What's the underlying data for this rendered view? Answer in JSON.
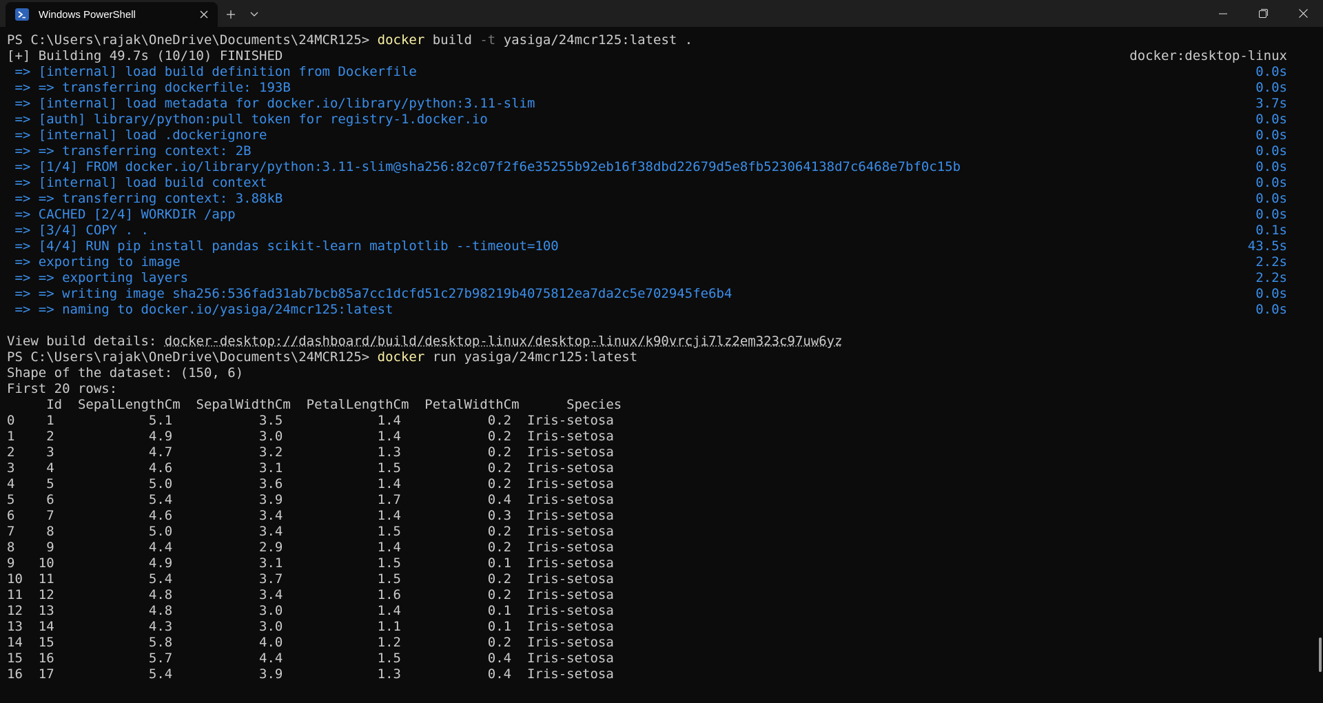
{
  "window": {
    "tab_title": "Windows PowerShell",
    "tab_icon": "powershell-icon",
    "colors": {
      "titlebar": "#1f1f1f",
      "terminal_bg": "#0c0c0c",
      "command": "#f9f1a5",
      "build_step": "#3b8eea",
      "text": "#cccccc"
    }
  },
  "terminal": {
    "prompt1": "PS C:\\Users\\rajak\\OneDrive\\Documents\\24MCR125> ",
    "cmd1_name": "docker",
    "cmd1_pre": " build ",
    "cmd1_flag": "-t",
    "cmd1_post": " yasiga/24mcr125:latest .",
    "build_header": "[+] Building 49.7s (10/10) FINISHED",
    "build_context": "docker:desktop-linux",
    "steps": [
      {
        "text": " => [internal] load build definition from Dockerfile",
        "time": "0.0s"
      },
      {
        "text": " => => transferring dockerfile: 193B",
        "time": "0.0s"
      },
      {
        "text": " => [internal] load metadata for docker.io/library/python:3.11-slim",
        "time": "3.7s"
      },
      {
        "text": " => [auth] library/python:pull token for registry-1.docker.io",
        "time": "0.0s"
      },
      {
        "text": " => [internal] load .dockerignore",
        "time": "0.0s"
      },
      {
        "text": " => => transferring context: 2B",
        "time": "0.0s"
      },
      {
        "text": " => [1/4] FROM docker.io/library/python:3.11-slim@sha256:82c07f2f6e35255b92eb16f38dbd22679d5e8fb523064138d7c6468e7bf0c15b",
        "time": "0.0s"
      },
      {
        "text": " => [internal] load build context",
        "time": "0.0s"
      },
      {
        "text": " => => transferring context: 3.88kB",
        "time": "0.0s"
      },
      {
        "text": " => CACHED [2/4] WORKDIR /app",
        "time": "0.0s"
      },
      {
        "text": " => [3/4] COPY . .",
        "time": "0.1s"
      },
      {
        "text": " => [4/4] RUN pip install pandas scikit-learn matplotlib --timeout=100",
        "time": "43.5s"
      },
      {
        "text": " => exporting to image",
        "time": "2.2s"
      },
      {
        "text": " => => exporting layers",
        "time": "2.2s"
      },
      {
        "text": " => => writing image sha256:536fad31ab7bcb85a7cc1dcfd51c27b98219b4075812ea7da2c5e702945fe6b4",
        "time": "0.0s"
      },
      {
        "text": " => => naming to docker.io/yasiga/24mcr125:latest",
        "time": "0.0s"
      }
    ],
    "view_label": "View build details: ",
    "view_link": "docker-desktop://dashboard/build/desktop-linux/desktop-linux/k90vrcji7lz2em323c97uw6yz",
    "prompt2": "PS C:\\Users\\rajak\\OneDrive\\Documents\\24MCR125> ",
    "cmd2_name": "docker",
    "cmd2_post": " run yasiga/24mcr125:latest",
    "shape_line": "Shape of the dataset: (150, 6)",
    "first_rows_line": "First 20 rows:",
    "table_header": "     Id  SepalLengthCm  SepalWidthCm  PetalLengthCm  PetalWidthCm      Species",
    "table_rows": [
      "0    1            5.1           3.5            1.4           0.2  Iris-setosa",
      "1    2            4.9           3.0            1.4           0.2  Iris-setosa",
      "2    3            4.7           3.2            1.3           0.2  Iris-setosa",
      "3    4            4.6           3.1            1.5           0.2  Iris-setosa",
      "4    5            5.0           3.6            1.4           0.2  Iris-setosa",
      "5    6            5.4           3.9            1.7           0.4  Iris-setosa",
      "6    7            4.6           3.4            1.4           0.3  Iris-setosa",
      "7    8            5.0           3.4            1.5           0.2  Iris-setosa",
      "8    9            4.4           2.9            1.4           0.2  Iris-setosa",
      "9   10            4.9           3.1            1.5           0.1  Iris-setosa",
      "10  11            5.4           3.7            1.5           0.2  Iris-setosa",
      "11  12            4.8           3.4            1.6           0.2  Iris-setosa",
      "12  13            4.8           3.0            1.4           0.1  Iris-setosa",
      "13  14            4.3           3.0            1.1           0.1  Iris-setosa",
      "14  15            5.8           4.0            1.2           0.2  Iris-setosa",
      "15  16            5.7           4.4            1.5           0.4  Iris-setosa",
      "16  17            5.4           3.9            1.3           0.4  Iris-setosa"
    ]
  }
}
